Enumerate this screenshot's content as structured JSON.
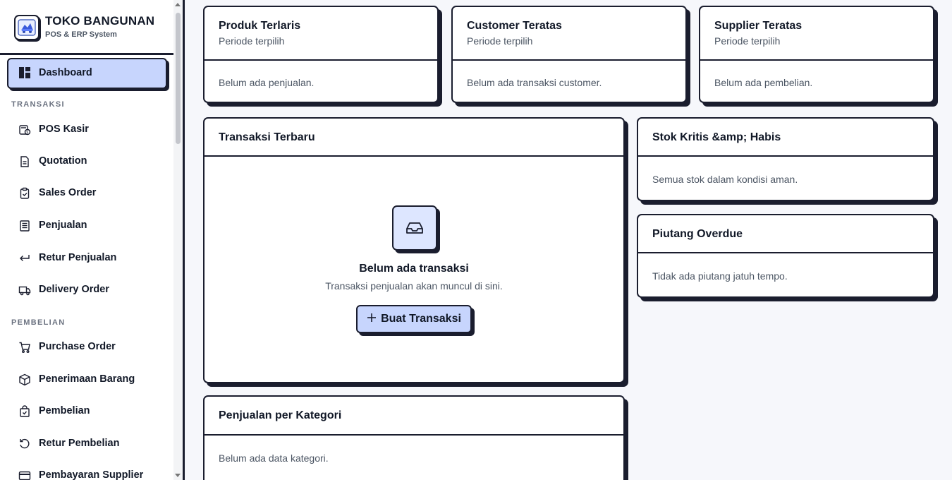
{
  "brand": {
    "title": "TOKO BANGUNAN",
    "subtitle": "POS & ERP System"
  },
  "sidebar": {
    "active": {
      "label": "Dashboard",
      "icon": "dashboard-icon"
    },
    "sections": [
      {
        "label": "TRANSAKSI",
        "items": [
          {
            "label": "POS Kasir",
            "icon": "pos-icon"
          },
          {
            "label": "Quotation",
            "icon": "document-icon"
          },
          {
            "label": "Sales Order",
            "icon": "clipboard-check-icon"
          },
          {
            "label": "Penjualan",
            "icon": "receipt-icon"
          },
          {
            "label": "Retur Penjualan",
            "icon": "return-arrow-icon"
          },
          {
            "label": "Delivery Order",
            "icon": "truck-icon"
          }
        ]
      },
      {
        "label": "PEMBELIAN",
        "items": [
          {
            "label": "Purchase Order",
            "icon": "cart-icon"
          },
          {
            "label": "Penerimaan Barang",
            "icon": "box-icon"
          },
          {
            "label": "Pembelian",
            "icon": "shopping-bag-icon"
          },
          {
            "label": "Retur Pembelian",
            "icon": "rotate-ccw-icon"
          },
          {
            "label": "Pembayaran Supplier",
            "icon": "credit-card-icon"
          }
        ]
      }
    ]
  },
  "cards": {
    "produk_terlaris": {
      "title": "Produk Terlaris",
      "subtitle": "Periode terpilih",
      "body": "Belum ada penjualan."
    },
    "customer_teratas": {
      "title": "Customer Teratas",
      "subtitle": "Periode terpilih",
      "body": "Belum ada transaksi customer."
    },
    "supplier_teratas": {
      "title": "Supplier Teratas",
      "subtitle": "Periode terpilih",
      "body": "Belum ada pembelian."
    },
    "transaksi_terbaru": {
      "title": "Transaksi Terbaru",
      "empty_title": "Belum ada transaksi",
      "empty_subtitle": "Transaksi penjualan akan muncul di sini.",
      "button_label": "Buat Transaksi"
    },
    "stok_kritis": {
      "title": "Stok Kritis &amp; Habis",
      "body": "Semua stok dalam kondisi aman."
    },
    "piutang_overdue": {
      "title": "Piutang Overdue",
      "body": "Tidak ada piutang jatuh tempo."
    },
    "penjualan_kategori": {
      "title": "Penjualan per Kategori",
      "body": "Belum ada data kategori."
    }
  },
  "colors": {
    "accent": "#c7d5fd",
    "border": "#1a1d2e",
    "background": "#f6f7fb"
  }
}
